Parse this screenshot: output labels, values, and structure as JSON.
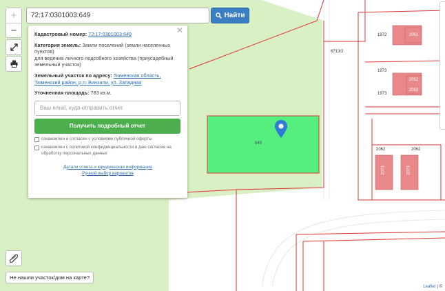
{
  "search": {
    "value": "72:17:0301003:649",
    "button_label": "Найти"
  },
  "zoom": {
    "in": "+",
    "out": "−"
  },
  "popup": {
    "cadastral_label": "Кадастровый номер:",
    "cadastral_value": "72:17:0301003:649",
    "category_label": "Категория земель:",
    "category_value": "Земли поселений (земли населенных пунктов)",
    "purpose": "для ведения личного подсобного хозяйства (приусадебный земельный участок)",
    "address_label": "Земельный участок по адресу:",
    "address_value": "Тюменская область, Тюменский район, р.п. Винзили, ул. Западная",
    "area_label": "Уточненная площадь:",
    "area_value": "783 кв.м.",
    "email_placeholder": "Ваш email, куда отправить отчет",
    "report_button": "Получить подробный отчет",
    "check1": "ознакомлен и согласен с условиями публичной оферты",
    "check2": "ознакомлен с политикой конфиденциальности и даю согласие на обработку персональных данных",
    "link_details": "Детали отчета и юридическая информация",
    "link_manual": "Ручной выбор вариантов"
  },
  "map": {
    "parcel_label": "649",
    "labels": {
      "l6713": "6713/2",
      "l1972": "1972",
      "l2051": "2051",
      "l1973a": "1973",
      "l1973b": "1973",
      "l2052": "2052",
      "l2053": "2053",
      "l2062a": "2062",
      "l2062b": "2062",
      "l2073a": "2073",
      "l2073b": "2073"
    },
    "colors": {
      "green_bg": "#d8f0c4",
      "parcel_fill": "#55ee7f",
      "parcel_border": "#dd3333",
      "building": "#e8888a",
      "marker": "#2f7bd4"
    }
  },
  "not_found_label": "Не нашли участок/дом на карте?",
  "attribution": {
    "leaflet": "Leaflet",
    "sep": "| ©"
  },
  "icons": {
    "search": "search-icon",
    "fullscreen": "fullscreen-icon",
    "print": "print-icon",
    "ruler": "ruler-icon",
    "close": "close-icon",
    "marker": "map-marker-icon"
  }
}
